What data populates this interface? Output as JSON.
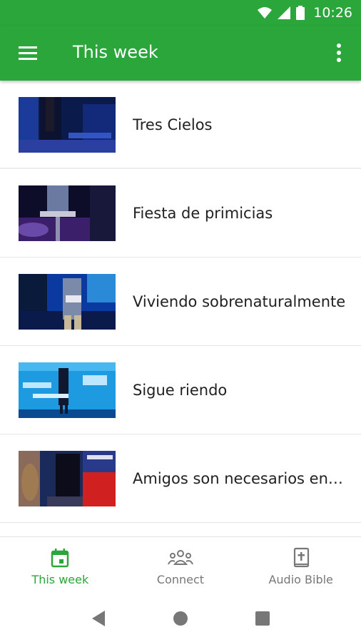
{
  "status_bar": {
    "time": "10:26"
  },
  "app_bar": {
    "title": "This week"
  },
  "colors": {
    "primary": "#2aa63a",
    "inactive": "#777777"
  },
  "items": [
    {
      "title": "Tres Cielos"
    },
    {
      "title": "Fiesta de primicias"
    },
    {
      "title": "Viviendo sobrenaturalmente"
    },
    {
      "title": "Sigue riendo"
    },
    {
      "title": "Amigos son necesarios en la vida"
    }
  ],
  "bottom_nav": [
    {
      "label": "This week",
      "icon": "calendar-icon",
      "active": true
    },
    {
      "label": "Connect",
      "icon": "group-icon",
      "active": false
    },
    {
      "label": "Audio Bible",
      "icon": "bible-icon",
      "active": false
    }
  ]
}
